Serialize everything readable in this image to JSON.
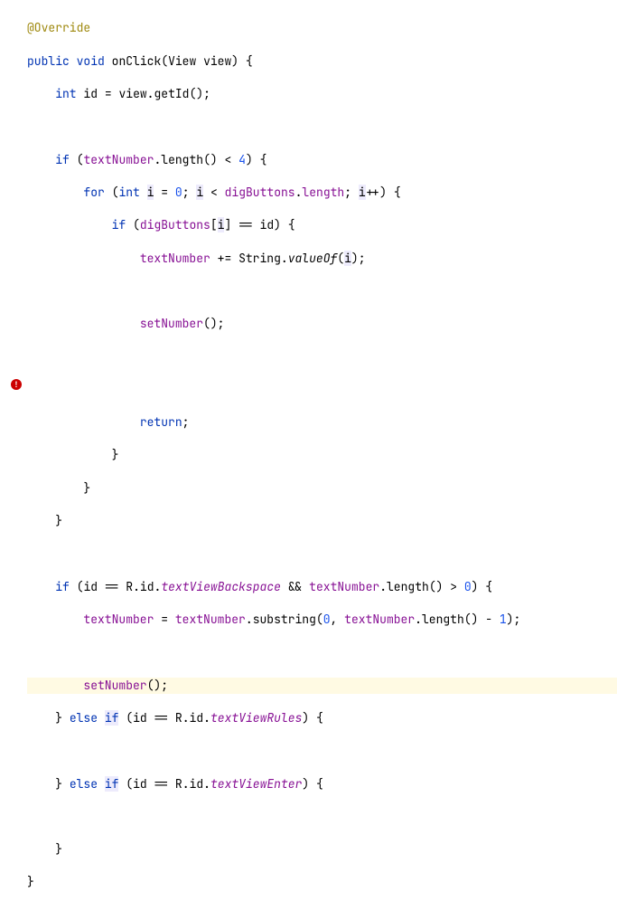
{
  "code": {
    "annotation": "@Override",
    "kw_public": "public",
    "kw_void": "void",
    "method_onClick": "onClick",
    "type_View": "View",
    "param_view": "view",
    "kw_int": "int",
    "var_id": "id",
    "var_view": "view",
    "call_getId": "getId",
    "kw_if": "if",
    "field_textNumber": "textNumber",
    "call_length": "length",
    "lt": "<",
    "num_4": "4",
    "kw_for": "for",
    "var_i": "i",
    "num_0": "0",
    "field_digButtons": "digButtons",
    "num_1": "1",
    "plusplus": "++",
    "eqeq": "==",
    "pluseq": "+=",
    "type_String": "String",
    "call_valueOf": "valueOf",
    "call_setNumber": "setNumber",
    "kw_return": "return",
    "type_R": "R",
    "field_id": "id",
    "field_textViewBackspace": "textViewBackspace",
    "andand": "&&",
    "gt": ">",
    "call_substring": "substring",
    "minus": "-",
    "kw_else": "else",
    "field_textViewRules": "textViewRules",
    "field_textViewEnter": "textViewEnter",
    "eq": "="
  },
  "icons": {
    "error": "!"
  }
}
